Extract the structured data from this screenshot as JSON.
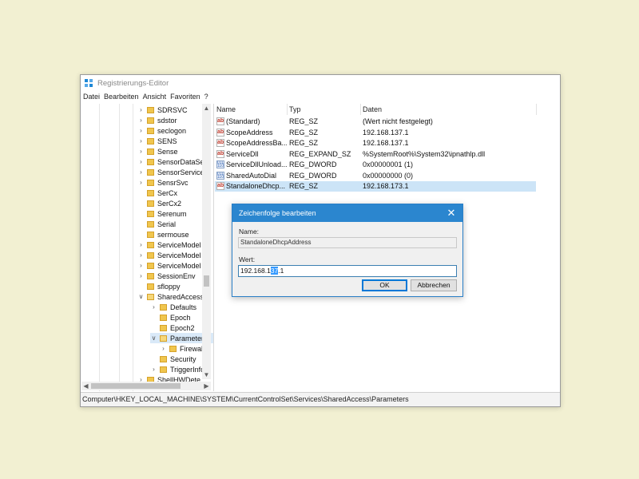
{
  "window": {
    "title": "Registrierungs-Editor"
  },
  "menu": [
    "Datei",
    "Bearbeiten",
    "Ansicht",
    "Favoriten",
    "?"
  ],
  "tree": {
    "items": [
      {
        "label": "SDRSVC",
        "level": 1,
        "expandable": true
      },
      {
        "label": "sdstor",
        "level": 1,
        "expandable": true
      },
      {
        "label": "seclogon",
        "level": 1,
        "expandable": true
      },
      {
        "label": "SENS",
        "level": 1,
        "expandable": true
      },
      {
        "label": "Sense",
        "level": 1,
        "expandable": true
      },
      {
        "label": "SensorDataSe",
        "level": 1,
        "expandable": true
      },
      {
        "label": "SensorService",
        "level": 1,
        "expandable": true
      },
      {
        "label": "SensrSvc",
        "level": 1,
        "expandable": true
      },
      {
        "label": "SerCx",
        "level": 1,
        "expandable": false
      },
      {
        "label": "SerCx2",
        "level": 1,
        "expandable": false
      },
      {
        "label": "Serenum",
        "level": 1,
        "expandable": false
      },
      {
        "label": "Serial",
        "level": 1,
        "expandable": false
      },
      {
        "label": "sermouse",
        "level": 1,
        "expandable": false
      },
      {
        "label": "ServiceModel",
        "level": 1,
        "expandable": true
      },
      {
        "label": "ServiceModel",
        "level": 1,
        "expandable": true
      },
      {
        "label": "ServiceModel",
        "level": 1,
        "expandable": true
      },
      {
        "label": "SessionEnv",
        "level": 1,
        "expandable": true
      },
      {
        "label": "sfloppy",
        "level": 1,
        "expandable": false
      },
      {
        "label": "SharedAccess",
        "level": 1,
        "expandable": true,
        "expanded": true
      },
      {
        "label": "Defaults",
        "level": 2,
        "expandable": true
      },
      {
        "label": "Epoch",
        "level": 2,
        "expandable": false
      },
      {
        "label": "Epoch2",
        "level": 2,
        "expandable": false
      },
      {
        "label": "Parameters",
        "level": 2,
        "expandable": true,
        "expanded": true,
        "selected": true
      },
      {
        "label": "Firewal",
        "level": 3,
        "expandable": true
      },
      {
        "label": "Security",
        "level": 2,
        "expandable": false
      },
      {
        "label": "TriggerInfo",
        "level": 2,
        "expandable": true
      },
      {
        "label": "ShellHWDete",
        "level": 1,
        "expandable": true
      }
    ]
  },
  "list": {
    "headers": [
      "Name",
      "Typ",
      "Daten"
    ],
    "rows": [
      {
        "icon": "string-value-icon",
        "name": "(Standard)",
        "type": "REG_SZ",
        "data": "(Wert nicht festgelegt)"
      },
      {
        "icon": "string-value-icon",
        "name": "ScopeAddress",
        "type": "REG_SZ",
        "data": "192.168.137.1"
      },
      {
        "icon": "string-value-icon",
        "name": "ScopeAddressBa...",
        "type": "REG_SZ",
        "data": "192.168.137.1"
      },
      {
        "icon": "string-value-icon",
        "name": "ServiceDll",
        "type": "REG_EXPAND_SZ",
        "data": "%SystemRoot%\\System32\\ipnathlp.dll"
      },
      {
        "icon": "binary-value-icon",
        "name": "ServiceDllUnload...",
        "type": "REG_DWORD",
        "data": "0x00000001 (1)"
      },
      {
        "icon": "binary-value-icon",
        "name": "SharedAutoDial",
        "type": "REG_DWORD",
        "data": "0x00000000 (0)"
      },
      {
        "icon": "string-value-icon",
        "name": "StandaloneDhcp...",
        "type": "REG_SZ",
        "data": "192.168.173.1",
        "selected": true
      }
    ]
  },
  "statusbar": {
    "path": "Computer\\HKEY_LOCAL_MACHINE\\SYSTEM\\CurrentControlSet\\Services\\SharedAccess\\Parameters"
  },
  "dialog": {
    "title": "Zeichenfolge bearbeiten",
    "name_label": "Name:",
    "name_value": "StandaloneDhcpAddress",
    "value_label": "Wert:",
    "value_before": "192.168.1",
    "value_selected": "37",
    "value_after": ".1",
    "ok_label": "OK",
    "cancel_label": "Abbrechen"
  },
  "colors": {
    "background": "#f2f0d2",
    "dialog_title": "#2b86cf",
    "selection": "#cce4f7"
  }
}
